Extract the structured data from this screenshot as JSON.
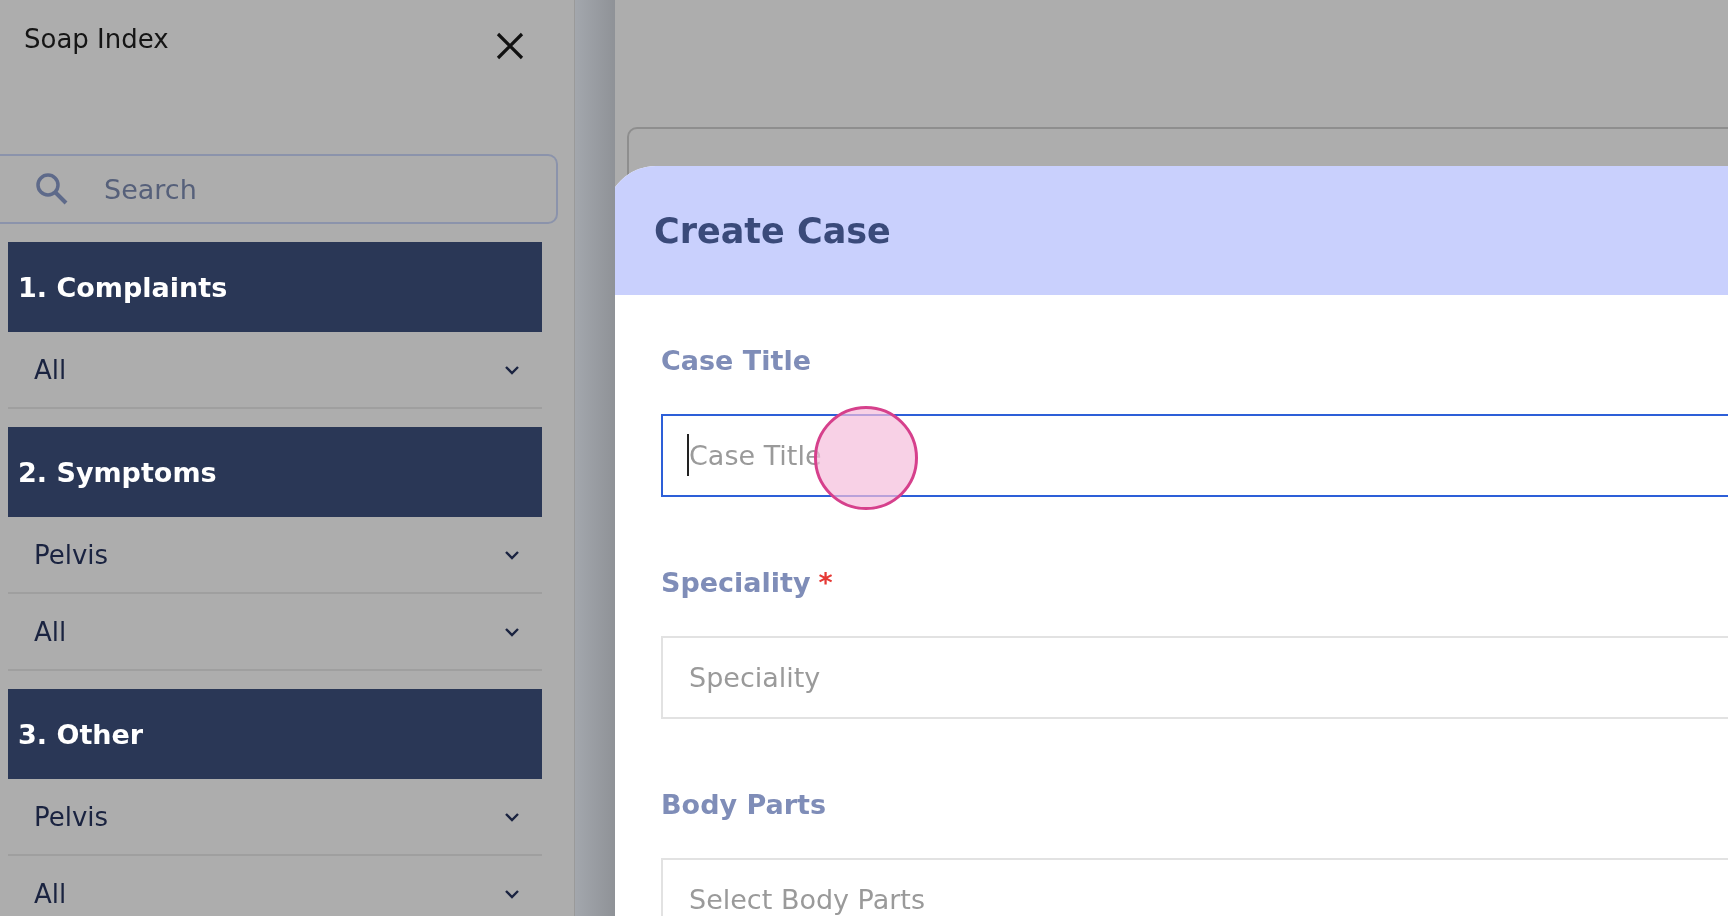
{
  "sidebar": {
    "title": "Soap Index",
    "search": {
      "placeholder": "Search"
    },
    "sections": [
      {
        "title": "1. Complaints",
        "rows": [
          "All"
        ]
      },
      {
        "title": "2. Symptoms",
        "rows": [
          "Pelvis",
          "All"
        ]
      },
      {
        "title": "3. Other",
        "rows": [
          "Pelvis",
          "All"
        ]
      }
    ]
  },
  "modal": {
    "title": "Create Case",
    "fields": [
      {
        "label": "Case Title",
        "placeholder": "Case Title",
        "focused": true
      },
      {
        "label": "Speciality",
        "required_mark": "*",
        "placeholder": "Speciality",
        "focused": false
      },
      {
        "label": "Body Parts",
        "placeholder": "Select Body Parts",
        "focused": false
      }
    ]
  }
}
